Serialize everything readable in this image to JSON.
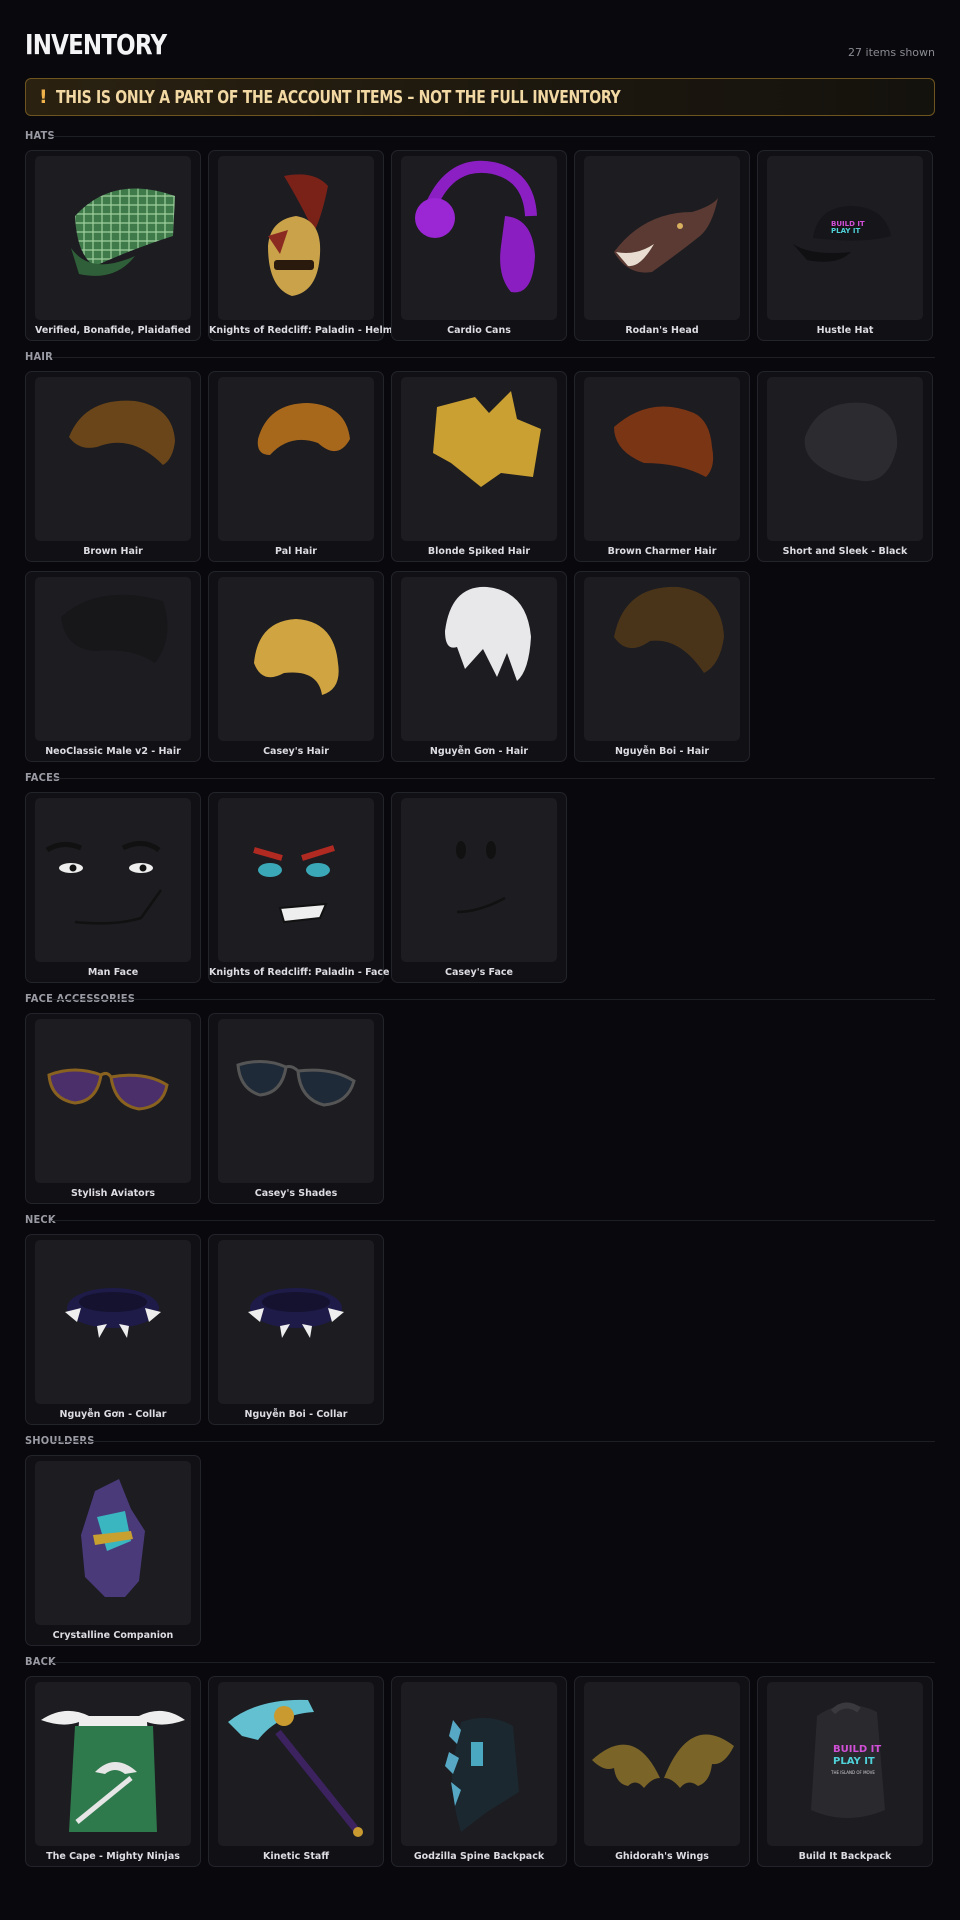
{
  "header": {
    "title": "INVENTORY",
    "count_text": "27 items shown"
  },
  "banner": {
    "icon": "!",
    "text": "THIS IS ONLY A PART OF THE ACCOUNT ITEMS – NOT THE FULL INVENTORY"
  },
  "colors": {
    "background": "#09090d",
    "card": "#101015",
    "thumb": "#1c1c21",
    "banner_text": "#f2d8a2",
    "banner_border": "#6e5520"
  },
  "sections": {
    "hats": {
      "label": "HATS",
      "items": [
        {
          "name": "Verified, Bonafide, Plaidafied",
          "icon": "plaid-cap-icon"
        },
        {
          "name": "Knights of Redcliff: Paladin - Helmet",
          "icon": "paladin-helmet-icon"
        },
        {
          "name": "Cardio Cans",
          "icon": "headphones-icon"
        },
        {
          "name": "Rodan's Head",
          "icon": "dragon-head-icon"
        },
        {
          "name": "Hustle Hat",
          "icon": "black-cap-icon"
        }
      ]
    },
    "hair": {
      "label": "HAIR",
      "items": [
        {
          "name": "Brown Hair",
          "icon": "hair-icon"
        },
        {
          "name": "Pal Hair",
          "icon": "hair-icon"
        },
        {
          "name": "Blonde Spiked Hair",
          "icon": "hair-icon"
        },
        {
          "name": "Brown Charmer Hair",
          "icon": "hair-icon"
        },
        {
          "name": "Short and Sleek - Black",
          "icon": "hair-icon"
        },
        {
          "name": "NeoClassic Male v2 - Hair",
          "icon": "hair-icon"
        },
        {
          "name": "Casey's Hair",
          "icon": "hair-icon"
        },
        {
          "name": "Nguyễn Gơn - Hair",
          "icon": "hair-icon"
        },
        {
          "name": "Nguyễn Boi - Hair",
          "icon": "hair-icon"
        }
      ]
    },
    "faces": {
      "label": "FACES",
      "items": [
        {
          "name": "Man Face",
          "icon": "face-icon"
        },
        {
          "name": "Knights of Redcliff: Paladin - Face",
          "icon": "face-icon"
        },
        {
          "name": "Casey's Face",
          "icon": "face-icon"
        }
      ]
    },
    "face_accessories": {
      "label": "FACE ACCESSORIES",
      "items": [
        {
          "name": "Stylish Aviators",
          "icon": "sunglasses-icon"
        },
        {
          "name": "Casey's Shades",
          "icon": "sunglasses-icon"
        }
      ]
    },
    "neck": {
      "label": "NECK",
      "items": [
        {
          "name": "Nguyễn Gơn - Collar",
          "icon": "spiked-collar-icon"
        },
        {
          "name": "Nguyễn Boi - Collar",
          "icon": "spiked-collar-icon"
        }
      ]
    },
    "shoulders": {
      "label": "SHOULDERS",
      "items": [
        {
          "name": "Crystalline Companion",
          "icon": "crystal-creature-icon"
        }
      ]
    },
    "back": {
      "label": "BACK",
      "items": [
        {
          "name": "The Cape - Mighty Ninjas",
          "icon": "cape-icon"
        },
        {
          "name": "Kinetic Staff",
          "icon": "staff-icon"
        },
        {
          "name": "Godzilla Spine Backpack",
          "icon": "spine-backpack-icon"
        },
        {
          "name": "Ghidorah's Wings",
          "icon": "wings-icon"
        },
        {
          "name": "Build It Backpack",
          "icon": "backpack-icon"
        }
      ]
    }
  },
  "artwork_text": {
    "build_it": "BUILD IT",
    "play_it": "PLAY IT",
    "island_of_move": "THE ISLAND OF MOVE"
  }
}
